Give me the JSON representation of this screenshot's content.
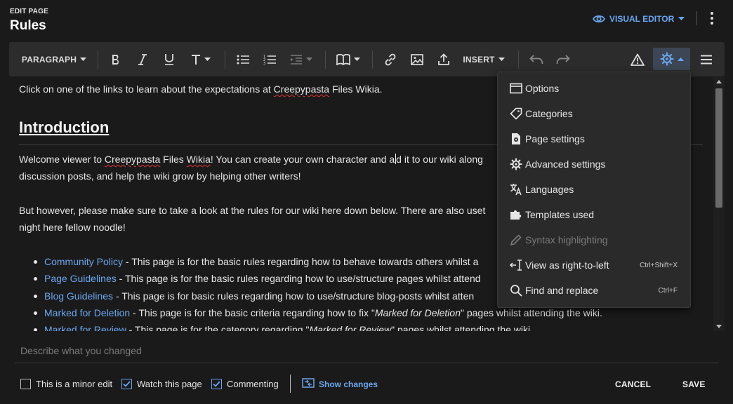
{
  "header": {
    "subtitle": "EDIT PAGE",
    "title": "Rules",
    "visual_editor_label": "VISUAL EDITOR"
  },
  "toolbar": {
    "paragraph_label": "PARAGRAPH",
    "insert_label": "INSERT"
  },
  "editor": {
    "intro_line_pre": "Click on one of the links to learn about the expectations at ",
    "intro_line_link": "Creepypasta",
    "intro_line_post": " Files Wikia.",
    "heading": "Introduction",
    "p1_a": "Welcome viewer to ",
    "p1_b": "Creepypasta",
    "p1_c": " Files ",
    "p1_d": "Wikia",
    "p1_e": "! You can create your own character and a",
    "p1_f": "d it to our wiki along",
    "p1_line2": "discussion posts, and help the wiki grow by helping other writers!",
    "p2_line1": "But however, please make sure to take a look at the rules for our wiki here down below. There are also uset",
    "p2_line2": "night here fellow noodle!",
    "list": [
      {
        "link": "Community Policy",
        "text": " - This page is for the basic rules regarding how to behave towards others whilst a"
      },
      {
        "link": "Page Guidelines",
        "text": " - This page is for the basic rules regarding how to use/structure pages whilst attend"
      },
      {
        "link": "Blog Guidelines",
        "text": " - This page is for basic rules regarding how to use/structure blog-posts whilst atten"
      },
      {
        "link": "Marked for Deletion",
        "text_a": " - This page is for the basic criteria regarding how to fix \"",
        "text_em": "Marked for Deletion",
        "text_b": "\" pages whilst attending the wiki."
      },
      {
        "link": "Marked for Review",
        "text_a": " - This page is for the category regarding \"",
        "text_em": "Marked for Review",
        "text_b": "\" pages whilst attending the wiki."
      }
    ]
  },
  "menu": {
    "items": [
      {
        "label": "Options",
        "icon": "window-icon",
        "shortcut": ""
      },
      {
        "label": "Categories",
        "icon": "tag-icon",
        "shortcut": ""
      },
      {
        "label": "Page settings",
        "icon": "page-gear-icon",
        "shortcut": ""
      },
      {
        "label": "Advanced settings",
        "icon": "gear-icon",
        "shortcut": ""
      },
      {
        "label": "Languages",
        "icon": "translate-icon",
        "shortcut": ""
      },
      {
        "label": "Templates used",
        "icon": "puzzle-icon",
        "shortcut": ""
      },
      {
        "label": "Syntax highlighting",
        "icon": "pencil-icon",
        "shortcut": "",
        "disabled": true
      },
      {
        "label": "View as right-to-left",
        "icon": "rtl-icon",
        "shortcut": "Ctrl+Shift+X"
      },
      {
        "label": "Find and replace",
        "icon": "search-icon",
        "shortcut": "Ctrl+F"
      }
    ]
  },
  "footer": {
    "summary_placeholder": "Describe what you changed",
    "minor_edit_label": "This is a minor edit",
    "watch_label": "Watch this page",
    "commenting_label": "Commenting",
    "show_changes_label": "Show changes",
    "cancel_label": "CANCEL",
    "save_label": "SAVE"
  },
  "colors": {
    "background": "#1a1a1a",
    "toolbar": "#2c2c2c",
    "accent": "#6aa7f0",
    "text": "#e6e6e6",
    "menu_bg": "#2a2a2a"
  }
}
